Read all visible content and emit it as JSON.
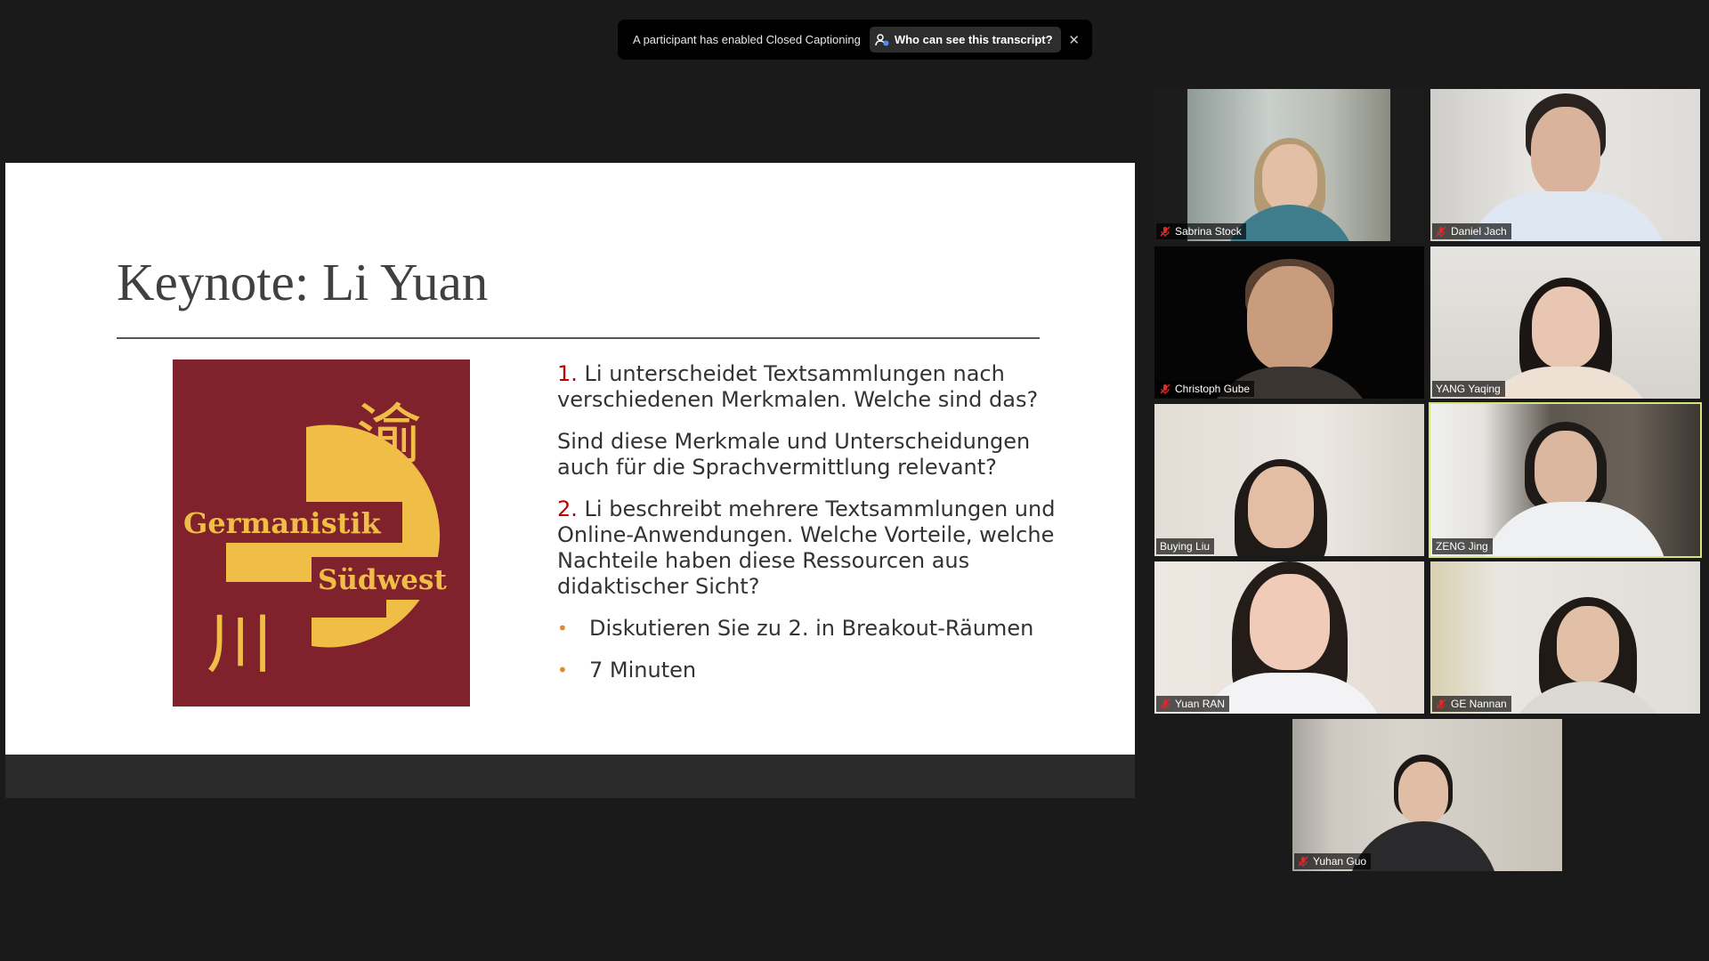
{
  "banner": {
    "message": "A participant has enabled Closed Captioning",
    "button_label": "Who can see this transcript?",
    "close_symbol": "✕"
  },
  "slide": {
    "title": "Keynote: Li Yuan",
    "logo": {
      "text_line1": "Germanistik",
      "text_line2": "Südwest",
      "char_top": "渝",
      "char_bottom": "川",
      "bg_color": "#7f222b",
      "accent_color": "#f0bd47"
    },
    "q1_num": "1.",
    "q1_text": " Li unterscheidet Textsammlungen nach verschiedenen Merkmalen. Welche sind das?",
    "q1_follow": "Sind diese Merkmale und Unterscheidungen auch für die Sprachvermittlung relevant?",
    "q2_num": "2.",
    "q2_text": " Li beschreibt mehrere Textsammlungen und Online-Anwendungen. Welche Vorteile, welche Nachteile haben diese Ressourcen aus didaktischer Sicht?",
    "bullets": [
      "Diskutieren Sie zu 2. in Breakout-Räumen",
      "7 Minuten"
    ]
  },
  "participants": [
    {
      "name": "Sabrina Stock",
      "muted": true
    },
    {
      "name": "Daniel Jach",
      "muted": true
    },
    {
      "name": "Christoph Gube",
      "muted": true
    },
    {
      "name": "YANG Yaqing",
      "muted": false
    },
    {
      "name": "Buying Liu",
      "muted": false
    },
    {
      "name": "ZENG Jing",
      "muted": false,
      "active_speaker": true
    },
    {
      "name": "Yuan RAN",
      "muted": true
    },
    {
      "name": "GE Nannan",
      "muted": true
    },
    {
      "name": "Yuhan Guo",
      "muted": true
    }
  ],
  "colors": {
    "muted_icon": "#e02828",
    "active_border": "#d6e37a",
    "number_red": "#c00000",
    "bullet_orange": "#e08a2c"
  }
}
